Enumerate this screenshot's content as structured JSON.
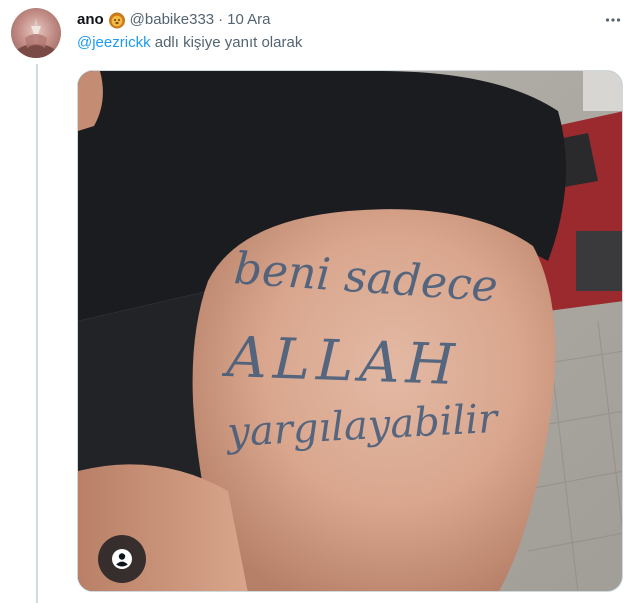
{
  "tweet": {
    "display_name": "ano",
    "badge_icon": "lion-emoji-icon",
    "handle": "@babike333",
    "separator": "·",
    "date": "10 Ara",
    "reply_to_handle": "@jeezrickk",
    "reply_suffix": " adlı kişiye yanıt olarak",
    "more_icon": "more-options-icon"
  },
  "media": {
    "tattoo_lines": [
      "beni sadece",
      "ALLAH",
      "yargılayabilir"
    ],
    "tag_icon": "person-tag-icon"
  },
  "colors": {
    "accent": "#1d9bf0",
    "text_primary": "#0f1419",
    "text_secondary": "#536471",
    "divider": "#cfd9de"
  }
}
